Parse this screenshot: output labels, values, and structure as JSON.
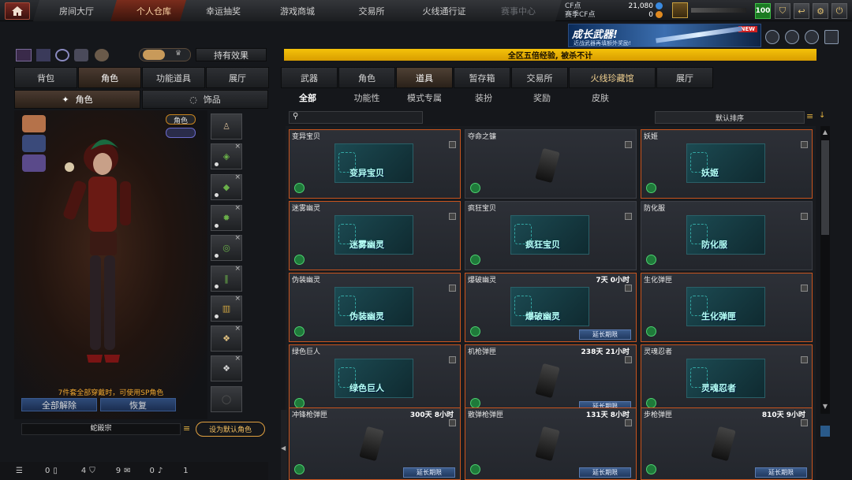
{
  "nav": {
    "tabs": [
      "房间大厅",
      "个人仓库",
      "幸运抽奖",
      "游戏商城",
      "交易所",
      "火线通行证",
      "赛事中心"
    ],
    "active_index": 1
  },
  "currency": {
    "cf_label": "CF点",
    "cf_value": "21,080",
    "season_label": "赛季CF点",
    "season_value": "0"
  },
  "level": "100",
  "banner": {
    "title": "成长武器!",
    "subtitle": "近战武器再填额外奖励!",
    "new_badge": "NEW"
  },
  "announcement": "全区五倍经验, 被杀不计",
  "left": {
    "effect_button": "持有效果",
    "tabs": [
      "背包",
      "角色",
      "功能道具",
      "展厅"
    ],
    "active_tab": 1,
    "subtabs": [
      "角色",
      "饰品"
    ],
    "role_tag": "角色",
    "set_notice": "7件套全部穿戴时，可使用SP角色",
    "unequip_all": "全部解除",
    "restore": "恢复",
    "character_name": "蛇殿宗",
    "set_default": "设为默认角色"
  },
  "right": {
    "tabs": [
      "武器",
      "角色",
      "道具",
      "暂存箱",
      "交易所",
      "火线珍藏馆",
      "展厅"
    ],
    "active_tab": 2,
    "subtabs": [
      "全部",
      "功能性",
      "模式专属",
      "装扮",
      "奖励",
      "皮肤"
    ],
    "active_subtab": 0,
    "sort_label": "默认排序",
    "extend_label": "延长期限"
  },
  "items": [
    {
      "name": "变异宝贝",
      "art_label": "变异宝贝",
      "time": "",
      "extend": false,
      "orange": true
    },
    {
      "name": "夺命之镰",
      "art_label": "",
      "time": "",
      "extend": false,
      "orange": false
    },
    {
      "name": "妖姬",
      "art_label": "妖姬",
      "time": "",
      "extend": false,
      "orange": true
    },
    {
      "name": "迷雾幽灵",
      "art_label": "迷雾幽灵",
      "time": "",
      "extend": false,
      "orange": true
    },
    {
      "name": "疯狂宝贝",
      "art_label": "疯狂宝贝",
      "time": "",
      "extend": false,
      "orange": false
    },
    {
      "name": "防化服",
      "art_label": "防化服",
      "time": "",
      "extend": false,
      "orange": false
    },
    {
      "name": "伪装幽灵",
      "art_label": "伪装幽灵",
      "time": "",
      "extend": false,
      "orange": true
    },
    {
      "name": "爆破幽灵",
      "art_label": "爆破幽灵",
      "time": "7天 0小时",
      "extend": true,
      "orange": true
    },
    {
      "name": "生化弹匣",
      "art_label": "生化弹匣",
      "time": "",
      "extend": false,
      "orange": true
    },
    {
      "name": "绿色巨人",
      "art_label": "绿色巨人",
      "time": "",
      "extend": false,
      "orange": true
    },
    {
      "name": "机枪弹匣",
      "art_label": "",
      "time": "238天 21小时",
      "extend": true,
      "orange": true
    },
    {
      "name": "灵魂忍者",
      "art_label": "灵魂忍者",
      "time": "",
      "extend": false,
      "orange": true
    },
    {
      "name": "冲锋枪弹匣",
      "art_label": "",
      "time": "300天 8小时",
      "extend": true,
      "orange": true
    },
    {
      "name": "散弹枪弹匣",
      "art_label": "",
      "time": "131天 8小时",
      "extend": true,
      "orange": true
    },
    {
      "name": "步枪弹匣",
      "art_label": "",
      "time": "810天 9小时",
      "extend": true,
      "orange": true
    }
  ],
  "bottom": {
    "counts": [
      "0",
      "4",
      "9",
      "0",
      "1"
    ]
  }
}
